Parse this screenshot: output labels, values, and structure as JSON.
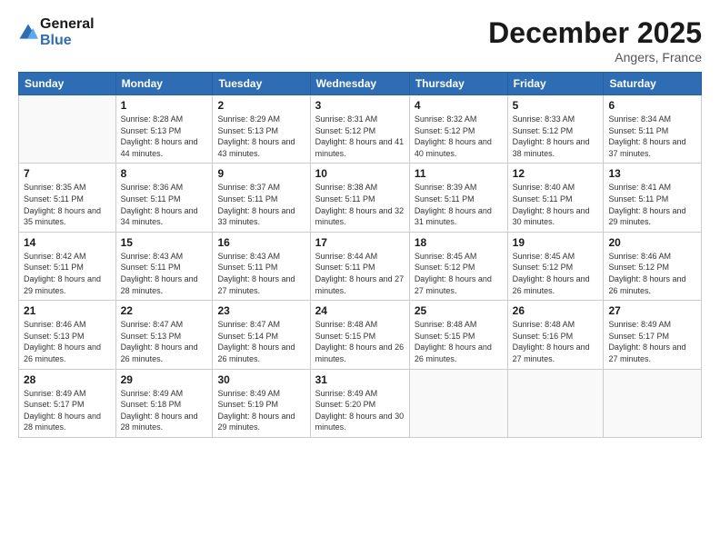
{
  "logo": {
    "line1": "General",
    "line2": "Blue"
  },
  "title": "December 2025",
  "location": "Angers, France",
  "days_of_week": [
    "Sunday",
    "Monday",
    "Tuesday",
    "Wednesday",
    "Thursday",
    "Friday",
    "Saturday"
  ],
  "weeks": [
    [
      {
        "day": "",
        "sunrise": "",
        "sunset": "",
        "daylight": ""
      },
      {
        "day": "1",
        "sunrise": "8:28 AM",
        "sunset": "5:13 PM",
        "daylight": "8 hours and 44 minutes."
      },
      {
        "day": "2",
        "sunrise": "8:29 AM",
        "sunset": "5:13 PM",
        "daylight": "8 hours and 43 minutes."
      },
      {
        "day": "3",
        "sunrise": "8:31 AM",
        "sunset": "5:12 PM",
        "daylight": "8 hours and 41 minutes."
      },
      {
        "day": "4",
        "sunrise": "8:32 AM",
        "sunset": "5:12 PM",
        "daylight": "8 hours and 40 minutes."
      },
      {
        "day": "5",
        "sunrise": "8:33 AM",
        "sunset": "5:12 PM",
        "daylight": "8 hours and 38 minutes."
      },
      {
        "day": "6",
        "sunrise": "8:34 AM",
        "sunset": "5:11 PM",
        "daylight": "8 hours and 37 minutes."
      }
    ],
    [
      {
        "day": "7",
        "sunrise": "8:35 AM",
        "sunset": "5:11 PM",
        "daylight": "8 hours and 35 minutes."
      },
      {
        "day": "8",
        "sunrise": "8:36 AM",
        "sunset": "5:11 PM",
        "daylight": "8 hours and 34 minutes."
      },
      {
        "day": "9",
        "sunrise": "8:37 AM",
        "sunset": "5:11 PM",
        "daylight": "8 hours and 33 minutes."
      },
      {
        "day": "10",
        "sunrise": "8:38 AM",
        "sunset": "5:11 PM",
        "daylight": "8 hours and 32 minutes."
      },
      {
        "day": "11",
        "sunrise": "8:39 AM",
        "sunset": "5:11 PM",
        "daylight": "8 hours and 31 minutes."
      },
      {
        "day": "12",
        "sunrise": "8:40 AM",
        "sunset": "5:11 PM",
        "daylight": "8 hours and 30 minutes."
      },
      {
        "day": "13",
        "sunrise": "8:41 AM",
        "sunset": "5:11 PM",
        "daylight": "8 hours and 29 minutes."
      }
    ],
    [
      {
        "day": "14",
        "sunrise": "8:42 AM",
        "sunset": "5:11 PM",
        "daylight": "8 hours and 29 minutes."
      },
      {
        "day": "15",
        "sunrise": "8:43 AM",
        "sunset": "5:11 PM",
        "daylight": "8 hours and 28 minutes."
      },
      {
        "day": "16",
        "sunrise": "8:43 AM",
        "sunset": "5:11 PM",
        "daylight": "8 hours and 27 minutes."
      },
      {
        "day": "17",
        "sunrise": "8:44 AM",
        "sunset": "5:11 PM",
        "daylight": "8 hours and 27 minutes."
      },
      {
        "day": "18",
        "sunrise": "8:45 AM",
        "sunset": "5:12 PM",
        "daylight": "8 hours and 27 minutes."
      },
      {
        "day": "19",
        "sunrise": "8:45 AM",
        "sunset": "5:12 PM",
        "daylight": "8 hours and 26 minutes."
      },
      {
        "day": "20",
        "sunrise": "8:46 AM",
        "sunset": "5:12 PM",
        "daylight": "8 hours and 26 minutes."
      }
    ],
    [
      {
        "day": "21",
        "sunrise": "8:46 AM",
        "sunset": "5:13 PM",
        "daylight": "8 hours and 26 minutes."
      },
      {
        "day": "22",
        "sunrise": "8:47 AM",
        "sunset": "5:13 PM",
        "daylight": "8 hours and 26 minutes."
      },
      {
        "day": "23",
        "sunrise": "8:47 AM",
        "sunset": "5:14 PM",
        "daylight": "8 hours and 26 minutes."
      },
      {
        "day": "24",
        "sunrise": "8:48 AM",
        "sunset": "5:15 PM",
        "daylight": "8 hours and 26 minutes."
      },
      {
        "day": "25",
        "sunrise": "8:48 AM",
        "sunset": "5:15 PM",
        "daylight": "8 hours and 26 minutes."
      },
      {
        "day": "26",
        "sunrise": "8:48 AM",
        "sunset": "5:16 PM",
        "daylight": "8 hours and 27 minutes."
      },
      {
        "day": "27",
        "sunrise": "8:49 AM",
        "sunset": "5:17 PM",
        "daylight": "8 hours and 27 minutes."
      }
    ],
    [
      {
        "day": "28",
        "sunrise": "8:49 AM",
        "sunset": "5:17 PM",
        "daylight": "8 hours and 28 minutes."
      },
      {
        "day": "29",
        "sunrise": "8:49 AM",
        "sunset": "5:18 PM",
        "daylight": "8 hours and 28 minutes."
      },
      {
        "day": "30",
        "sunrise": "8:49 AM",
        "sunset": "5:19 PM",
        "daylight": "8 hours and 29 minutes."
      },
      {
        "day": "31",
        "sunrise": "8:49 AM",
        "sunset": "5:20 PM",
        "daylight": "8 hours and 30 minutes."
      },
      {
        "day": "",
        "sunrise": "",
        "sunset": "",
        "daylight": ""
      },
      {
        "day": "",
        "sunrise": "",
        "sunset": "",
        "daylight": ""
      },
      {
        "day": "",
        "sunrise": "",
        "sunset": "",
        "daylight": ""
      }
    ]
  ]
}
